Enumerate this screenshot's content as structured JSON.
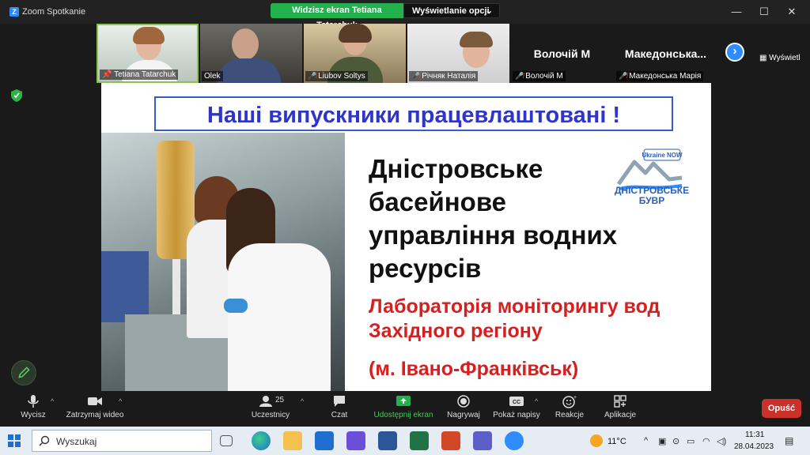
{
  "window": {
    "title": "Zoom Spotkanie",
    "share_banner": "Widzisz ekran Tetiana Tatarchuk",
    "view_options": "Wyświetlanie opcji",
    "view_button": "Wyświetl"
  },
  "gallery": {
    "participants": [
      {
        "name": "Tetiana Tatarchuk",
        "pinned": true,
        "muted": false
      },
      {
        "name": "Olek",
        "pinned": false,
        "muted": false
      },
      {
        "name": "Liubov Soltys",
        "pinned": false,
        "muted": true
      },
      {
        "name": "Річняк Наталія",
        "pinned": false,
        "muted": true
      },
      {
        "name": "Волочій М",
        "big_label": "Волочій М",
        "pinned": false,
        "muted": true
      },
      {
        "name": "Македонська Марія",
        "big_label": "Македонська...",
        "pinned": false,
        "muted": true
      }
    ]
  },
  "slide": {
    "title": "Наші випускники працевлаштовані !",
    "org_lines": [
      "Дністровське",
      "басейнове",
      "управління водних",
      "ресурсів"
    ],
    "lab_lines": [
      "Лабораторія моніторингу вод",
      "Західного регіону"
    ],
    "city": "(м. Івано-Франківськ)",
    "logo_badge": "Ukraine NOW",
    "logo_lines": [
      "ДНІСТРОВСЬКЕ",
      "БУВР"
    ]
  },
  "toolbar": {
    "mute": "Wycisz",
    "stop_video": "Zatrzymaj wideo",
    "participants_count": "25",
    "participants": "Uczestnicy",
    "chat": "Czat",
    "share": "Udostępnij ekran",
    "record": "Nagrywaj",
    "captions": "Pokaż napisy",
    "reactions": "Reakcje",
    "apps": "Aplikacje",
    "leave": "Opuść"
  },
  "taskbar": {
    "search_placeholder": "Wyszukaj",
    "temperature": "11°C",
    "time": "11:31",
    "date": "28.04.2023"
  },
  "colors": {
    "share_green": "#23b14d",
    "title_blue": "#2e35c9",
    "lab_red": "#d71f1f",
    "leave_red": "#c9312a",
    "zoom_blue": "#2d8cff"
  }
}
